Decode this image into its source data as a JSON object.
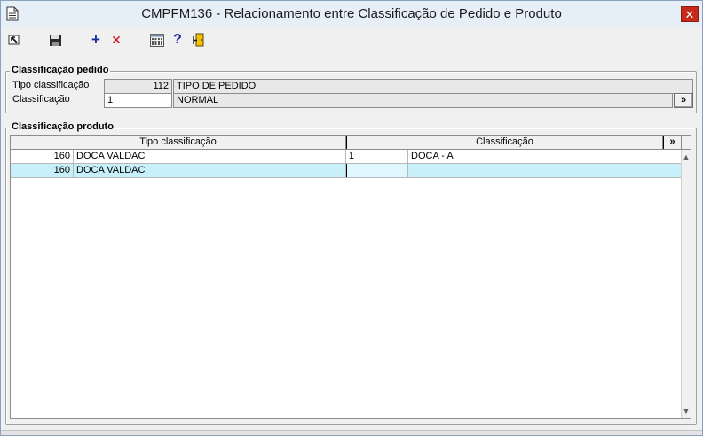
{
  "window": {
    "title": "CMPFM136 - Relacionamento entre Classificação de Pedido e Produto",
    "close_glyph": "✕"
  },
  "toolbar": {
    "icons": [
      "first-record-icon",
      "save-icon",
      "add-icon",
      "delete-icon",
      "calculator-icon",
      "help-icon",
      "exit-door-icon"
    ],
    "add_glyph": "+",
    "delete_glyph": "✕",
    "help_glyph": "?"
  },
  "pedido_group": {
    "title": "Classificação pedido",
    "tipo_label": "Tipo classificação",
    "tipo_code": "112",
    "tipo_desc": "TIPO DE PEDIDO",
    "class_label": "Classificação",
    "class_value": "1",
    "class_desc": "NORMAL",
    "lookup_glyph": "»"
  },
  "produto_group": {
    "title": "Classificação produto",
    "col_tipo": "Tipo classificação",
    "col_class": "Classificação",
    "expand_glyph": "»",
    "rows": [
      {
        "tipo_code": "160",
        "tipo_desc": "DOCA VALDAC",
        "class_code": "1",
        "class_desc": "DOCA - A"
      },
      {
        "tipo_code": "160",
        "tipo_desc": "DOCA VALDAC",
        "class_code": "",
        "class_desc": ""
      }
    ]
  },
  "scrollbar": {
    "up_glyph": "▲",
    "down_glyph": "▼"
  },
  "colors": {
    "selected_row": "#c8f0fa",
    "close_button": "#c42b1c",
    "toolbar_blue": "#1a2fa0",
    "toolbar_red": "#c81010"
  }
}
